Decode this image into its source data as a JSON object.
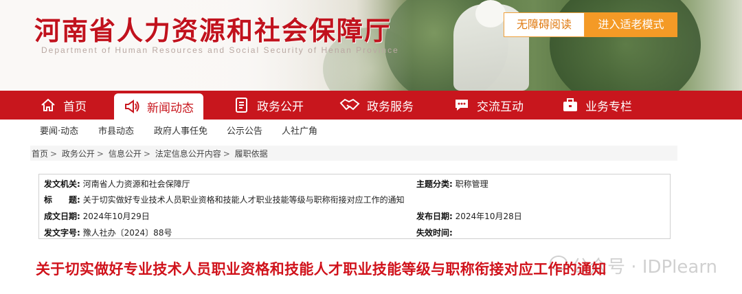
{
  "header": {
    "title": "河南省人力资源和社会保障厅",
    "subtitle": "Department of Human Resources and Social Security of Henan Province",
    "accessible_label": "无障碍阅读",
    "elder_mode_label": "进入适老模式"
  },
  "nav": {
    "items": [
      {
        "label": "首页",
        "icon": "home-icon"
      },
      {
        "label": "新闻动态",
        "icon": "megaphone-icon",
        "active": true
      },
      {
        "label": "政务公开",
        "icon": "document-icon"
      },
      {
        "label": "政务服务",
        "icon": "handshake-icon"
      },
      {
        "label": "交流互动",
        "icon": "chat-icon"
      },
      {
        "label": "业务专栏",
        "icon": "briefcase-icon"
      }
    ]
  },
  "subnav": {
    "items": [
      "要闻·动态",
      "市县动态",
      "政府人事任免",
      "公示公告",
      "人社广角"
    ]
  },
  "breadcrumb": {
    "items": [
      "首页",
      "政务公开",
      "信息公开",
      "法定信息公开内容",
      "履职依据"
    ]
  },
  "info": {
    "issuer_label": "发文机关:",
    "issuer": "河南省人力资源和社会保障厅",
    "topic_label": "主题分类:",
    "topic": "职称管理",
    "title_label": "标　　题:",
    "title": "关于切实做好专业技术人员职业资格和技能人才职业技能等级与职称衔接对应工作的通知",
    "created_label": "成文日期:",
    "created": "2024年10月29日",
    "published_label": "发布日期:",
    "published": "2024年10月28日",
    "doc_no_label": "发文字号:",
    "doc_no": "豫人社办〔2024〕88号",
    "expire_label": "失效时间:",
    "expire": ""
  },
  "article": {
    "title": "关于切实做好专业技术人员职业资格和技能人才职业技能等级与职称衔接对应工作的通知"
  },
  "watermark": {
    "text": "公众号 · IDPlearn"
  },
  "colors": {
    "brand_red": "#c8161d",
    "accent_orange": "#f49a26"
  }
}
